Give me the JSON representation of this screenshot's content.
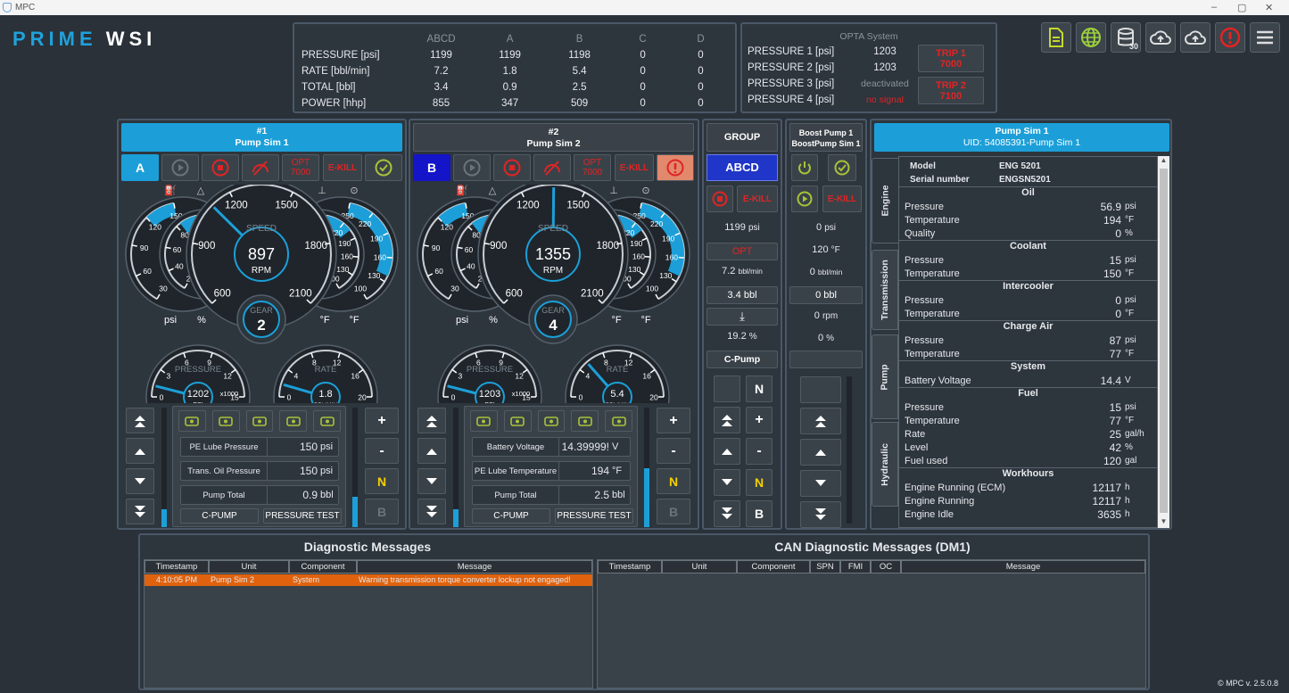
{
  "window": {
    "title": "MPC",
    "controls": [
      "–",
      "▢",
      "✕"
    ]
  },
  "logo": {
    "part1": "PRIME",
    "part2": "WSI"
  },
  "summary": {
    "headers": [
      "",
      "ABCD",
      "A",
      "B",
      "C",
      "D"
    ],
    "rows": [
      {
        "label": "PRESSURE [psi]",
        "values": [
          "1199",
          "1199",
          "1198",
          "0",
          "0"
        ]
      },
      {
        "label": "RATE [bbl/min]",
        "values": [
          "7.2",
          "1.8",
          "5.4",
          "0",
          "0"
        ]
      },
      {
        "label": "TOTAL [bbl]",
        "values": [
          "3.4",
          "0.9",
          "2.5",
          "0",
          "0"
        ]
      },
      {
        "label": "POWER [hhp]",
        "values": [
          "855",
          "347",
          "509",
          "0",
          "0"
        ]
      }
    ]
  },
  "opta": {
    "title": "OPTA System",
    "rows": [
      {
        "label": "PRESSURE 1 [psi]",
        "value": "1203"
      },
      {
        "label": "PRESSURE 2 [psi]",
        "value": "1203"
      },
      {
        "label": "PRESSURE 3 [psi]",
        "value": "deactivated"
      },
      {
        "label": "PRESSURE 4 [psi]",
        "value": "no signal"
      }
    ],
    "trip1": {
      "label": "TRIP 1",
      "value": "7000"
    },
    "trip2": {
      "label": "TRIP 2",
      "value": "7100"
    }
  },
  "toolbar": {
    "icons": [
      "document-icon",
      "globe-icon",
      "database-icon",
      "cloud-upload-icon",
      "cloud-upload-alt-icon",
      "alert-icon",
      "menu-icon"
    ],
    "db_count": "30"
  },
  "pump1": {
    "num": "#1",
    "name": "Pump Sim 1",
    "letter": "A",
    "opt": "OPT",
    "opt_val": "7000",
    "ekill": "E-KILL",
    "speed_label": "SPEED",
    "rpm": "897",
    "rpm_unit": "RPM",
    "gear_label": "GEAR",
    "gear": "2",
    "speed_ticks": [
      "600",
      "900",
      "1200",
      "1500",
      "1800",
      "2100"
    ],
    "left_a_ticks": [
      "150",
      "120",
      "90",
      "60",
      "30"
    ],
    "left_b_ticks": [
      "100",
      "80",
      "60",
      "40",
      "20"
    ],
    "right_a_ticks": [
      "250",
      "220",
      "190",
      "160",
      "130",
      "100"
    ],
    "right_b_ticks": [
      "250",
      "220",
      "190",
      "160",
      "130",
      "100"
    ],
    "unit_psi": "psi",
    "unit_pct": "%",
    "unit_f1": "°F",
    "unit_f2": "°F",
    "pressure_label": "PRESSURE",
    "pressure": "1202",
    "pressure_unit": "PSI",
    "pressure_mult": "x1000",
    "pressure_ticks": [
      "0",
      "3",
      "6",
      "9",
      "12",
      "15"
    ],
    "rate_label": "RATE",
    "rate": "1.8",
    "rate_unit": "BBL/MIN",
    "rate_ticks": [
      "0",
      "4",
      "8",
      "12",
      "16",
      "20"
    ],
    "fields": [
      {
        "label": "PE Lube Pressure",
        "value": "150",
        "unit": "psi"
      },
      {
        "label": "Trans. Oil Pressure",
        "value": "150",
        "unit": "psi"
      },
      {
        "label": "Pump Total",
        "value": "0.9",
        "unit": "bbl"
      }
    ],
    "cpump": "C-PUMP",
    "ptest": "PRESSURE TEST",
    "right_btns": [
      "+",
      "-",
      "N",
      "B"
    ]
  },
  "pump2": {
    "num": "#2",
    "name": "Pump Sim 2",
    "letter": "B",
    "opt": "OPT",
    "opt_val": "7000",
    "ekill": "E-KILL",
    "speed_label": "SPEED",
    "rpm": "1355",
    "rpm_unit": "RPM",
    "gear_label": "GEAR",
    "gear": "4",
    "speed_ticks": [
      "600",
      "900",
      "1200",
      "1500",
      "1800",
      "2100"
    ],
    "left_a_ticks": [
      "150",
      "120",
      "90",
      "60",
      "30"
    ],
    "left_b_ticks": [
      "100",
      "80",
      "60",
      "40",
      "20"
    ],
    "right_a_ticks": [
      "250",
      "220",
      "190",
      "160",
      "130",
      "100"
    ],
    "right_b_ticks": [
      "250",
      "220",
      "190",
      "160",
      "130",
      "100"
    ],
    "unit_psi": "psi",
    "unit_pct": "%",
    "unit_f1": "°F",
    "unit_f2": "°F",
    "pressure_label": "PRESSURE",
    "pressure": "1203",
    "pressure_unit": "PSI",
    "pressure_mult": "x1000",
    "pressure_ticks": [
      "0",
      "3",
      "6",
      "9",
      "12",
      "15"
    ],
    "rate_label": "RATE",
    "rate": "5.4",
    "rate_unit": "BBL/MIN",
    "rate_ticks": [
      "0",
      "4",
      "8",
      "12",
      "16",
      "20"
    ],
    "fields": [
      {
        "label": "Battery Voltage",
        "value": "14.39999!",
        "unit": "V"
      },
      {
        "label": "PE Lube Temperature",
        "value": "194",
        "unit": "°F"
      },
      {
        "label": "Pump Total",
        "value": "2.5",
        "unit": "bbl"
      }
    ],
    "cpump": "C-PUMP",
    "ptest": "PRESSURE TEST",
    "right_btns": [
      "+",
      "-",
      "N",
      "B"
    ]
  },
  "group": {
    "title": "GROUP",
    "letters": "ABCD",
    "ekill": "E-KILL",
    "values": [
      {
        "v": "1199",
        "u": "psi"
      },
      {
        "v": "OPT",
        "u": ""
      },
      {
        "v": "7.2",
        "u": "bbl/min"
      },
      {
        "v": "3.4",
        "u": "bbl"
      },
      {
        "v": "⤓",
        "u": ""
      },
      {
        "v": "19.2",
        "u": "%"
      },
      {
        "v": "C-Pump",
        "u": ""
      }
    ],
    "btns": [
      "N",
      "+",
      "-",
      "N",
      "B"
    ]
  },
  "boost": {
    "title1": "Boost Pump 1",
    "title2": "BoostPump Sim 1",
    "ekill": "E-KILL",
    "values": [
      {
        "v": "0",
        "u": "psi"
      },
      {
        "v": "120",
        "u": "°F"
      },
      {
        "v": "0",
        "u": "bbl/min"
      },
      {
        "v": "0",
        "u": "bbl"
      },
      {
        "v": "0",
        "u": "rpm"
      },
      {
        "v": "0",
        "u": "%"
      }
    ]
  },
  "detail": {
    "title": "Pump Sim 1",
    "uid": "UID: 54085391-Pump Sim 1",
    "tabs": [
      "Engine",
      "Transmission",
      "Pump",
      "Hydraulic"
    ],
    "model_label": "Model",
    "model": "ENG 5201",
    "serial_label": "Serial number",
    "serial": "ENGSN5201",
    "sections": [
      {
        "title": "Oil",
        "rows": [
          {
            "k": "Pressure",
            "v": "56.9",
            "u": "psi"
          },
          {
            "k": "Temperature",
            "v": "194",
            "u": "°F"
          },
          {
            "k": "Quality",
            "v": "0",
            "u": "%"
          }
        ]
      },
      {
        "title": "Coolant",
        "rows": [
          {
            "k": "Pressure",
            "v": "15",
            "u": "psi"
          },
          {
            "k": "Temperature",
            "v": "150",
            "u": "°F"
          }
        ]
      },
      {
        "title": "Intercooler",
        "rows": [
          {
            "k": "Pressure",
            "v": "0",
            "u": "psi"
          },
          {
            "k": "Temperature",
            "v": "0",
            "u": "°F"
          }
        ]
      },
      {
        "title": "Charge Air",
        "rows": [
          {
            "k": "Pressure",
            "v": "87",
            "u": "psi"
          },
          {
            "k": "Temperature",
            "v": "77",
            "u": "°F"
          }
        ]
      },
      {
        "title": "System",
        "rows": [
          {
            "k": "Battery Voltage",
            "v": "14.4",
            "u": "V"
          }
        ]
      },
      {
        "title": "Fuel",
        "rows": [
          {
            "k": "Pressure",
            "v": "15",
            "u": "psi"
          },
          {
            "k": "Temperature",
            "v": "77",
            "u": "°F"
          },
          {
            "k": "Rate",
            "v": "25",
            "u": "gal/h"
          },
          {
            "k": "Level",
            "v": "42",
            "u": "%"
          },
          {
            "k": "Fuel used",
            "v": "120",
            "u": "gal"
          }
        ]
      },
      {
        "title": "Workhours",
        "rows": [
          {
            "k": "Engine Running (ECM)",
            "v": "12117",
            "u": "h"
          },
          {
            "k": "Engine Running",
            "v": "12117",
            "u": "h"
          },
          {
            "k": "Engine Idle",
            "v": "3635",
            "u": "h"
          }
        ]
      }
    ]
  },
  "diag": {
    "title": "Diagnostic Messages",
    "headers": [
      "Timestamp",
      "Unit",
      "Component",
      "Message"
    ],
    "rows": [
      {
        "ts": "4:10:05 PM",
        "unit": "Pump Sim 2",
        "comp": "System",
        "msg": "Warning transmission torque converter lockup not engaged!"
      }
    ]
  },
  "can": {
    "title": "CAN Diagnostic Messages (DM1)",
    "headers": [
      "Timestamp",
      "Unit",
      "Component",
      "SPN",
      "FMI",
      "OC",
      "Message"
    ]
  },
  "version": "© MPC v. 2.5.0.8",
  "colors": {
    "accent": "#1c9fd8",
    "bg": "#2a3138",
    "warning_row": "#e0620e",
    "danger": "#e02424",
    "ok": "#a9c23a"
  }
}
